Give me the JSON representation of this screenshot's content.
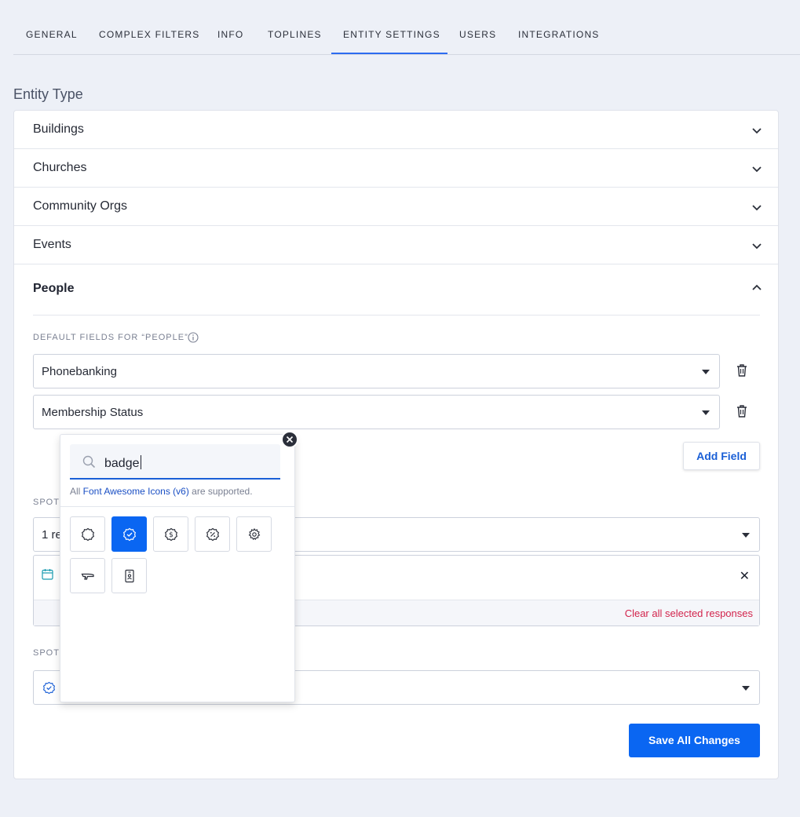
{
  "tabs": [
    {
      "label": "GENERAL"
    },
    {
      "label": "COMPLEX FILTERS"
    },
    {
      "label": "INFO"
    },
    {
      "label": "TOPLINES"
    },
    {
      "label": "ENTITY SETTINGS",
      "active": true
    },
    {
      "label": "USERS"
    },
    {
      "label": "INTEGRATIONS"
    }
  ],
  "section_title": "Entity Type",
  "entity_types": [
    {
      "label": "Buildings",
      "expanded": false
    },
    {
      "label": "Churches",
      "expanded": false
    },
    {
      "label": "Community Orgs",
      "expanded": false
    },
    {
      "label": "Events",
      "expanded": false
    },
    {
      "label": "People",
      "expanded": true
    }
  ],
  "people": {
    "default_fields_label": "DEFAULT FIELDS FOR “PEOPLE”",
    "fields": [
      {
        "value": "Phonebanking"
      },
      {
        "value": "Membership Status"
      }
    ],
    "add_field_label": "Add Field",
    "spotlight_label_1": "SPOTI",
    "spotlight_select_1": "1 re",
    "clear_all_label": "Clear all selected responses",
    "spotlight_label_2": "SPOTI",
    "save_label": "Save All Changes"
  },
  "icon_picker": {
    "search_value": "badge",
    "hint_prefix": "All ",
    "hint_link": "Font Awesome Icons (v6)",
    "hint_suffix": " are supported.",
    "icons": [
      {
        "name": "certificate-outline",
        "selected": false
      },
      {
        "name": "badge-check",
        "selected": true
      },
      {
        "name": "badge-dollar",
        "selected": false
      },
      {
        "name": "badge-percent",
        "selected": false
      },
      {
        "name": "badge-gear",
        "selected": false
      },
      {
        "name": "hand-holding",
        "selected": false
      },
      {
        "name": "id-badge",
        "selected": false
      }
    ]
  },
  "colors": {
    "accent": "#0a66f2",
    "link": "#1a5fd6",
    "danger": "#d2244c",
    "background": "#edf0f7"
  }
}
